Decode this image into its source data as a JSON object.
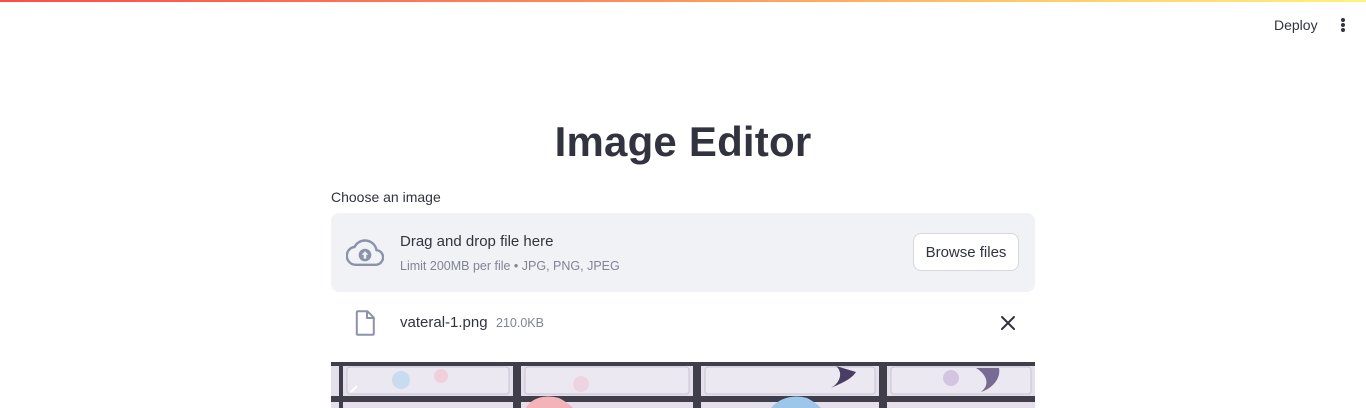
{
  "header": {
    "deploy_label": "Deploy",
    "menu_icon": "more-vertical-icon"
  },
  "page": {
    "title": "Image Editor"
  },
  "uploader": {
    "label": "Choose an image",
    "dropzone_title": "Drag and drop file here",
    "dropzone_limit": "Limit 200MB per file • JPG, PNG, JPEG",
    "browse_label": "Browse files",
    "icon": "cloud-upload-icon"
  },
  "uploaded_file": {
    "name": "vateral-1.png",
    "size": "210.0KB",
    "icon": "file-icon",
    "remove_icon": "close-icon"
  },
  "colors": {
    "accent": "#ff4b4b",
    "text": "#31333f",
    "muted": "#808495",
    "dropzone_bg": "#f0f2f6"
  }
}
